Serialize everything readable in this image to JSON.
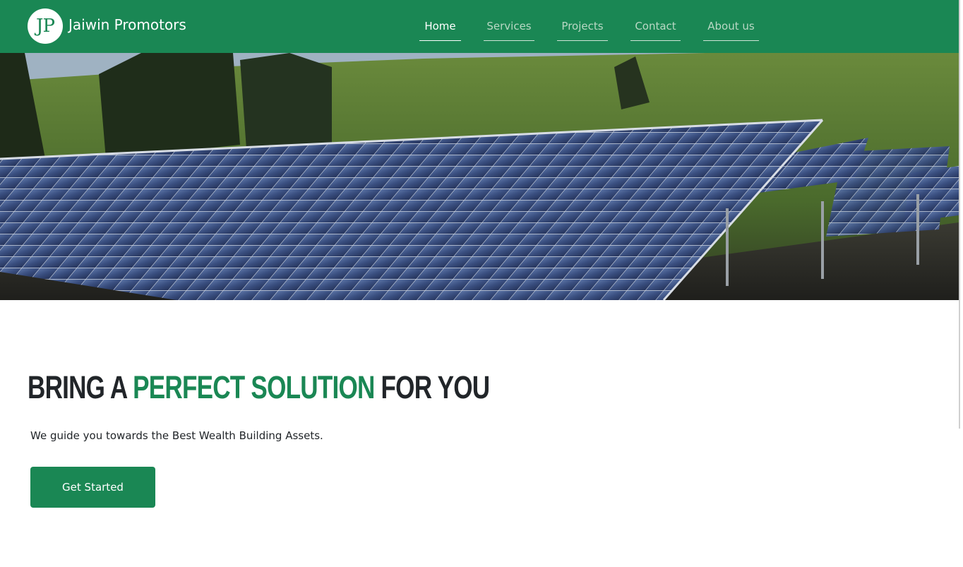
{
  "brand": {
    "logo_text": "JP",
    "name": "Jaiwin Promotors"
  },
  "nav": {
    "items": [
      {
        "label": "Home",
        "active": true
      },
      {
        "label": "Services",
        "active": false
      },
      {
        "label": "Projects",
        "active": false
      },
      {
        "label": "Contact",
        "active": false
      },
      {
        "label": "About us",
        "active": false
      }
    ]
  },
  "hero": {
    "image": "solar-panels-photo"
  },
  "headline": {
    "part1": "BRING A ",
    "accent": "PERFECT SOLUTION",
    "part2": " FOR YOU"
  },
  "tagline": "We guide you towards the Best Wealth Building Assets.",
  "cta_label": "Get Started",
  "colors": {
    "brand_green": "#1a8754",
    "heading_dark": "#212529"
  }
}
